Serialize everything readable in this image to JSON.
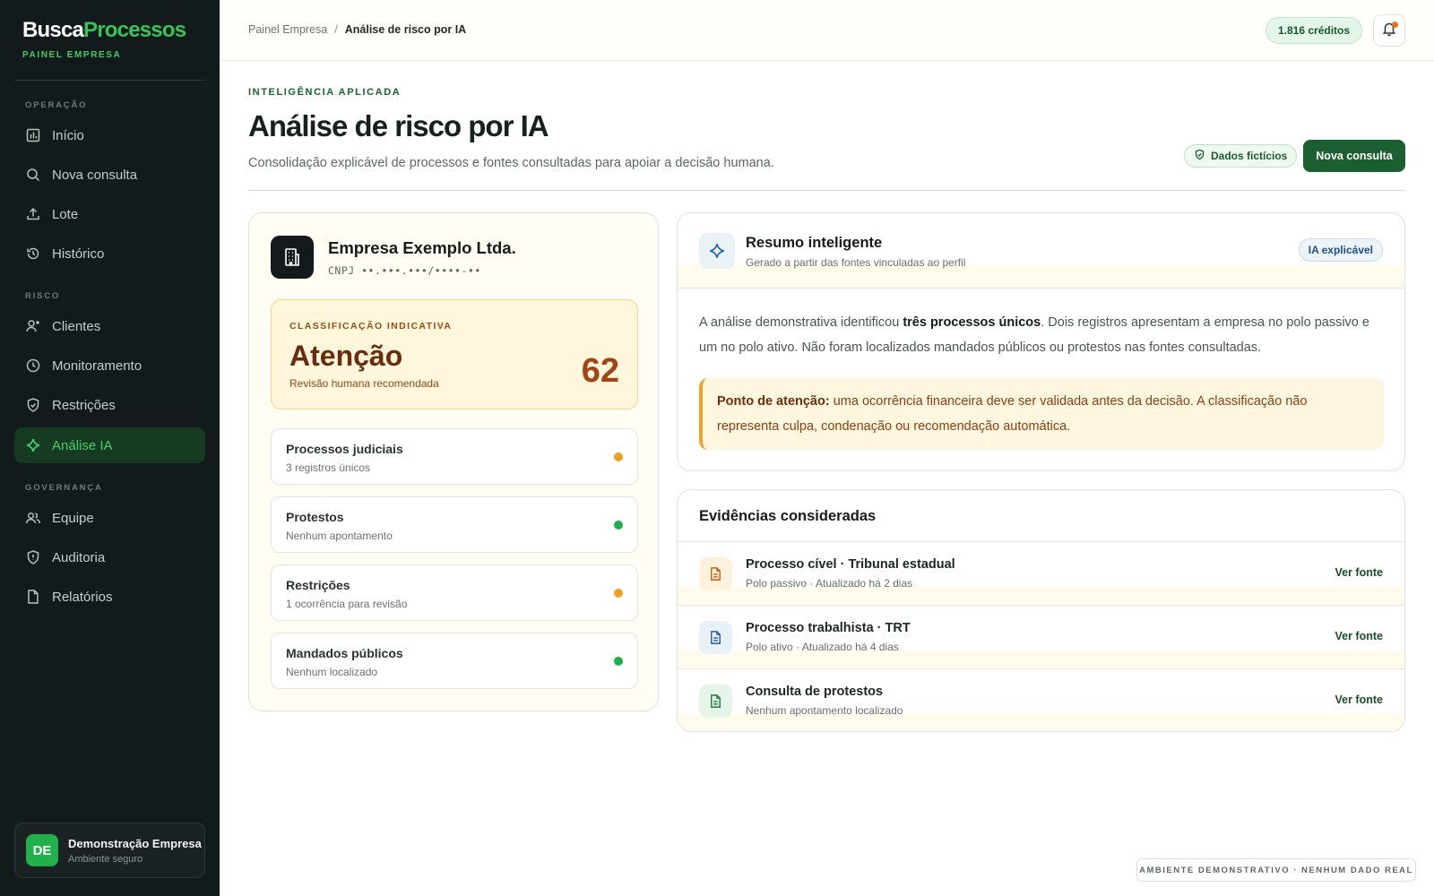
{
  "sidebar": {
    "brand_part1": "Busca",
    "brand_part2": "Processos",
    "brand_sub": "PAINEL EMPRESA",
    "sections": {
      "operacao": "OPERAÇÃO",
      "risco": "RISCO",
      "governanca": "GOVERNANÇA"
    },
    "items": {
      "inicio": "Início",
      "nova_consulta": "Nova consulta",
      "lote": "Lote",
      "historico": "Histórico",
      "clientes": "Clientes",
      "monitoramento": "Monitoramento",
      "restricoes": "Restrições",
      "analise_ia": "Análise IA",
      "equipe": "Equipe",
      "auditoria": "Auditoria",
      "relatorios": "Relatórios"
    },
    "active_item": "analise_ia",
    "user": {
      "initials": "DE",
      "name": "Demonstração Empresa",
      "subtitle": "Ambiente seguro"
    }
  },
  "topbar": {
    "breadcrumb_root": "Painel Empresa",
    "breadcrumb_sep": "/",
    "breadcrumb_current": "Análise de risco por IA",
    "credits": "1.816 créditos",
    "bell_icon": "bell-icon"
  },
  "header": {
    "eyebrow": "INTELIGÊNCIA APLICADA",
    "title": "Análise de risco por IA",
    "subtitle": "Consolidação explicável de processos e fontes consultadas para apoiar a decisão humana.",
    "badge": "Dados fictícios",
    "new_button": "Nova consulta"
  },
  "company": {
    "name": "Empresa Exemplo Ltda.",
    "cnpj": "CNPJ ••.•••.•••/••••-••",
    "risk_label": "CLASSIFICAÇÃO INDICATIVA",
    "risk_level": "Atenção",
    "risk_note": "Revisão humana recomendada",
    "risk_score": "62",
    "factors": [
      {
        "title": "Processos judiciais",
        "sub": "3 registros únicos",
        "status": "warning"
      },
      {
        "title": "Protestos",
        "sub": "Nenhum apontamento",
        "status": "ok"
      },
      {
        "title": "Restrições",
        "sub": "1 ocorrência para revisão",
        "status": "warning"
      },
      {
        "title": "Mandados públicos",
        "sub": "Nenhum localizado",
        "status": "ok"
      }
    ]
  },
  "summary": {
    "title": "Resumo inteligente",
    "subtitle": "Gerado a partir das fontes vinculadas ao perfil",
    "badge": "IA explicável",
    "body_pre": "A análise demonstrativa identificou ",
    "body_bold": "três processos únicos",
    "body_post": ". Dois registros apresentam a empresa no polo passivo e um no polo ativo. Não foram localizados mandados públicos ou protestos nas fontes consultadas.",
    "attention_label": "Ponto de atenção:",
    "attention_text": " uma ocorrência financeira deve ser validada antes da decisão. A classificação não representa culpa, condenação ou recomendação automática."
  },
  "evidence": {
    "title": "Evidências consideradas",
    "link_label": "Ver fonte",
    "rows": [
      {
        "name": "Processo cível · Tribunal estadual",
        "meta": "Polo passivo · Atualizado há 2 dias",
        "tone": "amber"
      },
      {
        "name": "Processo trabalhista · TRT",
        "meta": "Polo ativo · Atualizado há 4 dias",
        "tone": "blue"
      },
      {
        "name": "Consulta de protestos",
        "meta": "Nenhum apontamento localizado",
        "tone": "green"
      }
    ]
  },
  "colors": {
    "sidebar_bg": "#131a1c",
    "accent_green": "#37c25a",
    "primary_button": "#1b5e31",
    "warning_dot": "#f0a020",
    "ok_dot": "#1faf48"
  },
  "footer_badge": "AMBIENTE DEMONSTRATIVO · NENHUM DADO REAL"
}
